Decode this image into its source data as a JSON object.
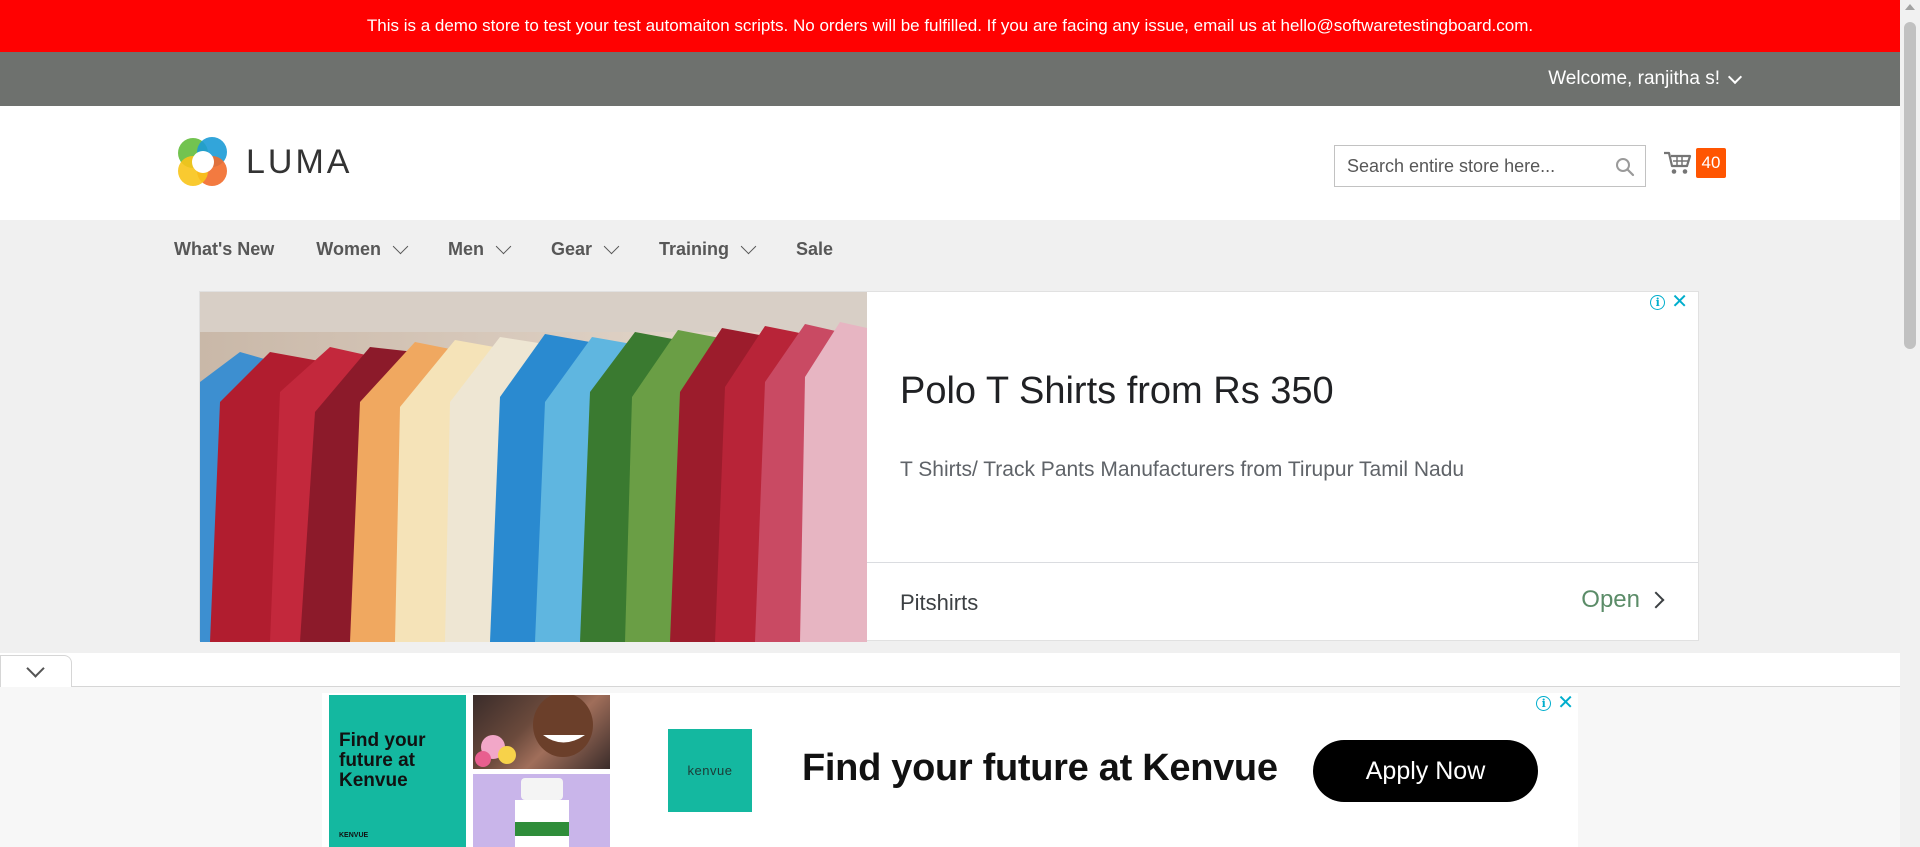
{
  "demo_banner": {
    "text": "This is a demo store to test your test automaiton scripts. No orders will be fulfilled. If you are facing any issue, email us at hello@softwaretestingboard.com."
  },
  "panel_header": {
    "welcome": "Welcome, ranjitha s!"
  },
  "header": {
    "logo_text": "LUMA",
    "search_placeholder": "Search entire store here...",
    "search_value": "",
    "cart_count": "40"
  },
  "nav": {
    "items": [
      {
        "label": "What's New",
        "has_dropdown": false
      },
      {
        "label": "Women",
        "has_dropdown": true
      },
      {
        "label": "Men",
        "has_dropdown": true
      },
      {
        "label": "Gear",
        "has_dropdown": true
      },
      {
        "label": "Training",
        "has_dropdown": true
      },
      {
        "label": "Sale",
        "has_dropdown": false
      }
    ]
  },
  "ad_top": {
    "title": "Polo T Shirts from Rs 350",
    "description": "T Shirts/ Track Pants Manufacturers from Tirupur Tamil Nadu",
    "brand": "Pitshirts",
    "cta": "Open"
  },
  "ad_bottom": {
    "panel_text": "Find your future at Kenvue",
    "panel_logo": "KENVUE",
    "logo_text": "kenvue",
    "headline": "Find your future at Kenvue",
    "cta": "Apply Now"
  },
  "colors": {
    "banner": "#ff0101",
    "panel": "#6e716e",
    "cart_badge": "#ff5501",
    "nav_bg": "#f0f0f0",
    "ad_link": "#5b8c68",
    "kenvue_teal": "#14b8a0"
  }
}
